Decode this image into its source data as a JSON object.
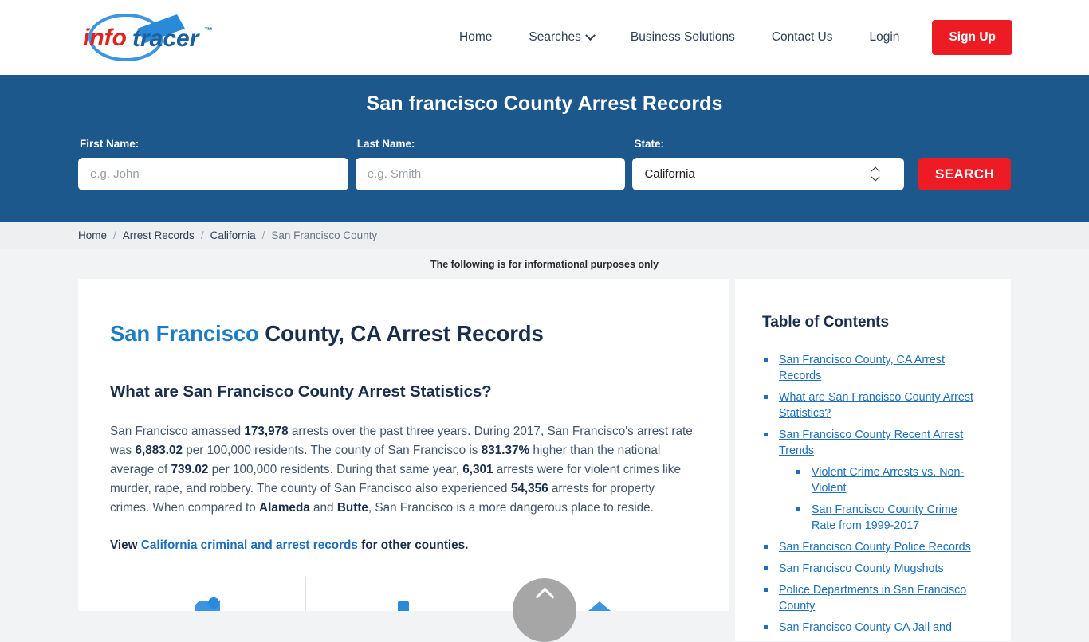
{
  "brand": {
    "name_part1": "info",
    "name_part2": "tracer",
    "trademark": "™",
    "color_red": "#e2201c",
    "color_blue": "#1c5f9e",
    "color_lightblue": "#3c95e0"
  },
  "nav": {
    "items": [
      {
        "label": "Home",
        "has_caret": false
      },
      {
        "label": "Searches",
        "has_caret": true
      },
      {
        "label": "Business Solutions",
        "has_caret": false
      },
      {
        "label": "Contact Us",
        "has_caret": false
      },
      {
        "label": "Login",
        "has_caret": false
      }
    ],
    "signup_label": "Sign Up"
  },
  "banner": {
    "title": "San francisco County Arrest Records",
    "background_color": "#1d588d",
    "first_name": {
      "label": "First Name:",
      "placeholder": "e.g. John",
      "value": ""
    },
    "last_name": {
      "label": "Last Name:",
      "placeholder": "e.g. Smith",
      "value": ""
    },
    "state": {
      "label": "State:",
      "value": "California"
    },
    "search_label": "SEARCH"
  },
  "breadcrumb": {
    "separator": "/",
    "items": [
      {
        "label": "Home",
        "current": false
      },
      {
        "label": "Arrest Records",
        "current": false
      },
      {
        "label": "California",
        "current": false
      },
      {
        "label": "San Francisco County",
        "current": true
      }
    ]
  },
  "disclaimer": "The following is for informational purposes only",
  "main": {
    "title_highlight": "San Francisco",
    "title_rest": " County, CA Arrest Records",
    "section_heading": "What are San Francisco County Arrest Statistics?",
    "paragraph": {
      "p1": "San Francisco amassed ",
      "stat_total_arrests": "173,978",
      "p2": " arrests over the past three years. During 2017, San Francisco's arrest rate was ",
      "stat_arrest_rate": "6,883.02",
      "p3": " per 100,000 residents. The county of San Francisco is ",
      "stat_percent_higher": "831.37%",
      "p4": " higher than the national average of ",
      "stat_national_average": "739.02",
      "p5": " per 100,000 residents. During that same year, ",
      "stat_violent_arrests": "6,301",
      "p6": " arrests were for violent crimes like murder, rape, and robbery. The county of San Francisco also experienced ",
      "stat_property_arrests": "54,356",
      "p7": " arrests for property crimes. When compared to ",
      "county_compare_1": "Alameda",
      "p8": " and ",
      "county_compare_2": "Butte",
      "p9": ", San Francisco is a more dangerous place to reside."
    },
    "view_line": {
      "prefix": "View ",
      "link": "California criminal and arrest records",
      "suffix": " for other counties."
    }
  },
  "toc": {
    "title": "Table of Contents",
    "items": [
      {
        "label": "San Francisco County, CA Arrest Records",
        "children": []
      },
      {
        "label": "What are San Francisco County Arrest Statistics?",
        "children": []
      },
      {
        "label": "San Francisco County Recent Arrest Trends",
        "children": [
          {
            "label": "Violent Crime Arrests vs. Non-Violent"
          },
          {
            "label": "San Francisco County Crime Rate from 1999-2017"
          }
        ]
      },
      {
        "label": "San Francisco County Police Records",
        "children": []
      },
      {
        "label": "San Francisco County Mugshots",
        "children": []
      },
      {
        "label": "Police Departments in San Francisco County",
        "children": []
      },
      {
        "label": "San Francisco County CA Jail and",
        "children": []
      }
    ]
  },
  "scroll_top": {
    "label": ""
  }
}
